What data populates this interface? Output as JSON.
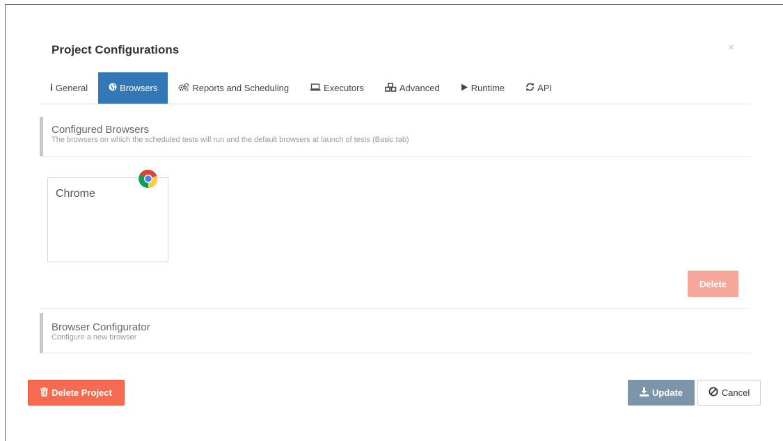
{
  "dialog": {
    "title": "Project Configurations",
    "close_glyph": "×"
  },
  "tabs": [
    {
      "label": "General",
      "icon": "info-icon",
      "glyph": "i"
    },
    {
      "label": "Browsers",
      "icon": "globe-icon",
      "glyph": "🌐",
      "active": true
    },
    {
      "label": "Reports and Scheduling",
      "icon": "gears-icon",
      "glyph": "⚙"
    },
    {
      "label": "Executors",
      "icon": "laptop-icon",
      "glyph": "💻"
    },
    {
      "label": "Advanced",
      "icon": "cubes-icon",
      "glyph": "⛃"
    },
    {
      "label": "Runtime",
      "icon": "play-icon",
      "glyph": "▶"
    },
    {
      "label": "API",
      "icon": "refresh-icon",
      "glyph": "⟳"
    }
  ],
  "configured": {
    "heading": "Configured Browsers",
    "description": "The browsers on which the scheduled tests will run and the default browsers at launch of tests (Basic tab)",
    "browsers": [
      {
        "name": "Chrome",
        "icon": "chrome-icon"
      }
    ],
    "delete_label": "Delete"
  },
  "configurator": {
    "heading": "Browser Configurator",
    "description": "Configure a new browser"
  },
  "footer": {
    "delete_project_label": "Delete Project",
    "update_label": "Update",
    "cancel_label": "Cancel"
  },
  "colors": {
    "accent": "#3278b6",
    "danger": "#f46b52",
    "danger_light": "#f5a79a",
    "update": "#7c95aa"
  }
}
